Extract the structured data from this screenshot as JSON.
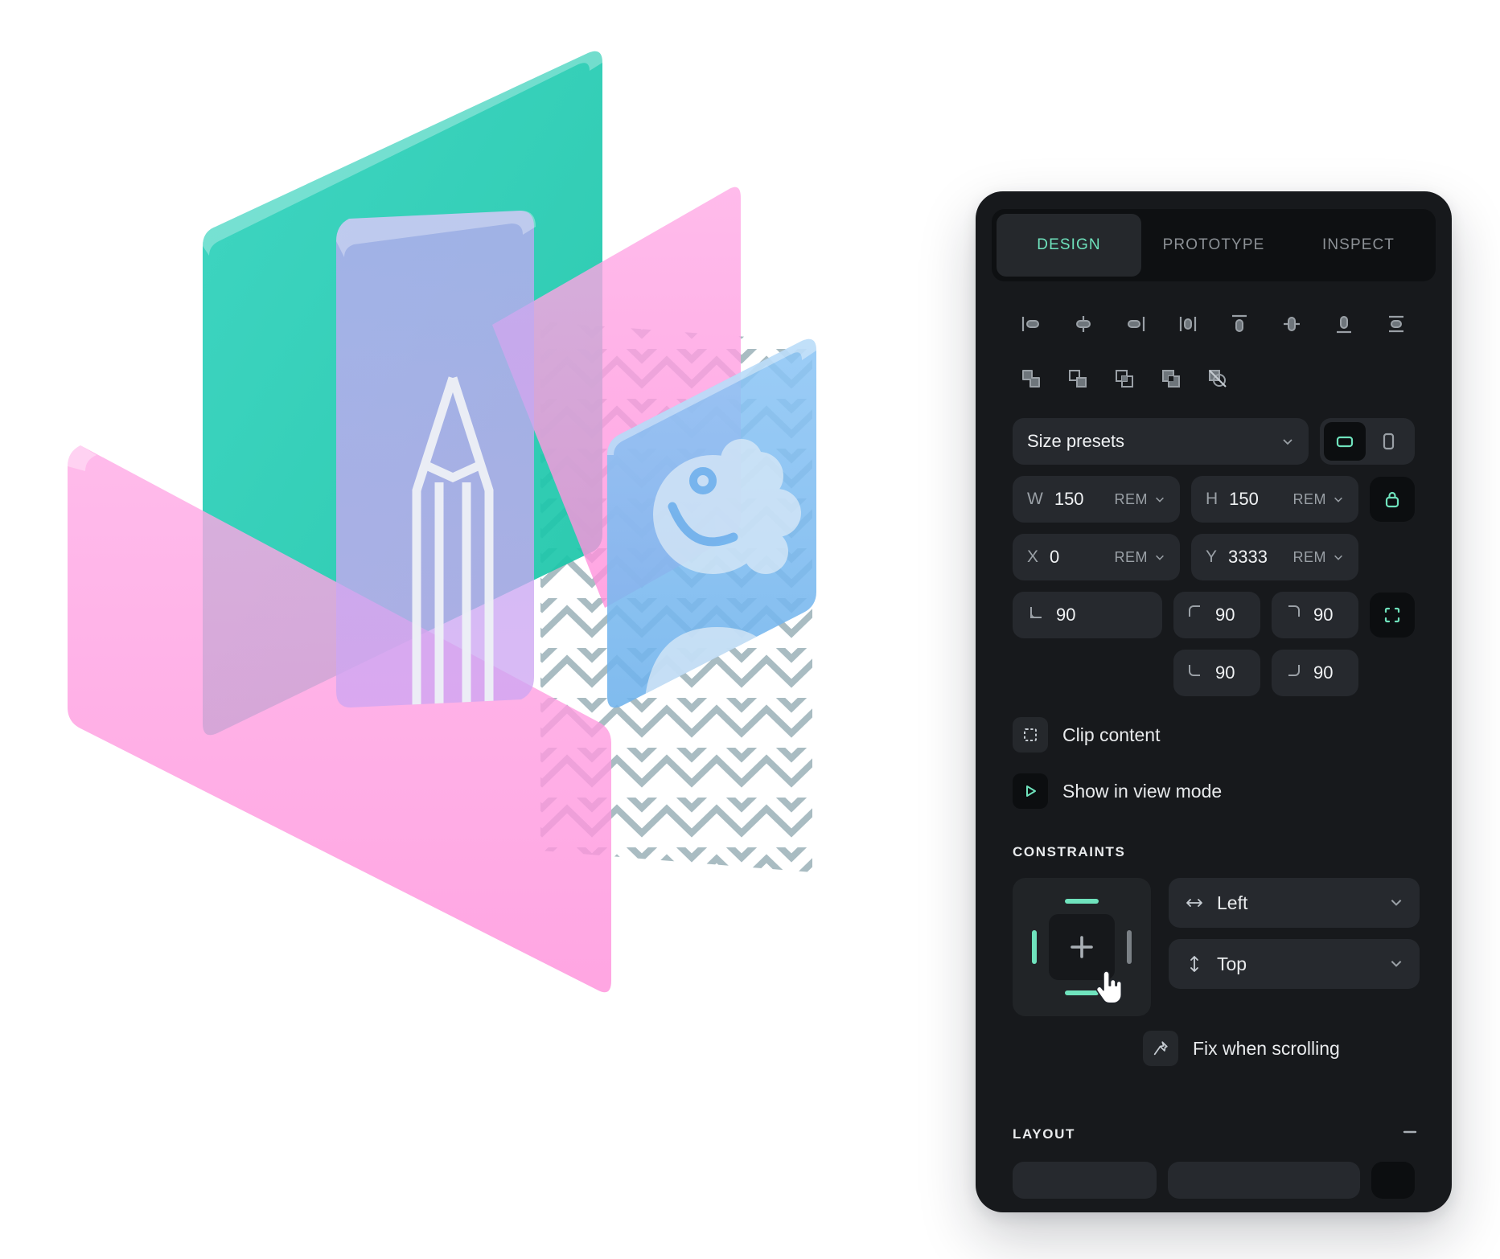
{
  "panel": {
    "tabs": [
      {
        "label": "DESIGN",
        "active": true
      },
      {
        "label": "PROTOTYPE",
        "active": false
      },
      {
        "label": "INSPECT",
        "active": false
      }
    ],
    "align_icons": [
      "align-left-icon",
      "align-horizontal-center-icon",
      "align-right-icon",
      "distribute-horizontal-icon",
      "align-top-icon",
      "align-vertical-center-icon",
      "align-bottom-icon",
      "distribute-vertical-icon"
    ],
    "boolean_icons": [
      "union-selection-icon",
      "subtract-selection-icon",
      "intersect-selection-icon",
      "exclude-selection-icon",
      "flatten-selection-icon"
    ],
    "size_presets": {
      "label": "Size presets",
      "caret": "chevron-down-icon",
      "orientation": {
        "landscape": "landscape-icon",
        "portrait": "portrait-icon",
        "selected": "landscape"
      }
    },
    "dimensions": {
      "w_label": "W",
      "w_value": "150",
      "w_unit": "REM",
      "h_label": "H",
      "h_value": "150",
      "h_unit": "REM",
      "lock": "lock-icon",
      "lock_active": true
    },
    "position": {
      "x_label": "X",
      "x_value": "0",
      "x_unit": "REM",
      "y_label": "Y",
      "y_value": "3333",
      "y_unit": "REM"
    },
    "rotation": {
      "icon": "angle-icon",
      "value": "90"
    },
    "corners": {
      "top_left": {
        "icon": "corner-top-left-icon",
        "value": "90"
      },
      "top_right": {
        "icon": "corner-top-right-icon",
        "value": "90"
      },
      "bottom_left": {
        "icon": "corner-bottom-left-icon",
        "value": "90"
      },
      "bottom_right": {
        "icon": "corner-bottom-right-icon",
        "value": "90"
      },
      "independent": {
        "icon": "independent-corners-icon",
        "active": true
      }
    },
    "toggles": [
      {
        "icon": "clip-content-icon",
        "label": "Clip content",
        "active": false
      },
      {
        "icon": "play-icon",
        "label": "Show in view mode",
        "active": true
      }
    ],
    "constraints": {
      "title": "CONSTRAINTS",
      "grid": {
        "center_icon": "plus-icon",
        "top_active": true,
        "bottom_active": true,
        "left_active": true,
        "right_active": false
      },
      "horizontal": {
        "icon": "horizontal-arrows-icon",
        "value": "Left",
        "caret": "chevron-down-icon"
      },
      "vertical": {
        "icon": "vertical-arrows-icon",
        "value": "Top",
        "caret": "chevron-down-icon"
      },
      "fix_when_scrolling": {
        "icon": "pin-icon",
        "label": "Fix when scrolling"
      }
    },
    "layout": {
      "title": "LAYOUT",
      "collapse": "minus-icon"
    }
  },
  "colors": {
    "accent": "#6fe3bd",
    "panel_bg": "#17191c",
    "field_bg": "#26292e",
    "tabbar_bg": "#0e1012",
    "teal_plane": "#1fc8ac",
    "pink_plane": "#ff9fe0",
    "purple_plane": "#b9a4f0",
    "blue_plane": "#79b9f0",
    "zigzag": "#a9bcc2"
  },
  "artwork": {
    "planes": [
      {
        "name": "teal-plane",
        "color": "#1fc8ac"
      },
      {
        "name": "pink-plane-right",
        "color": "#ff9fe0"
      },
      {
        "name": "pink-plane-left",
        "color": "#ff9fe0"
      },
      {
        "name": "purple-plane",
        "color": "#b9a4f0"
      },
      {
        "name": "blue-plane",
        "color": "#79b9f0"
      }
    ],
    "motifs": [
      "pencil-icon",
      "avatar-face-icon",
      "zigzag-pattern"
    ]
  }
}
